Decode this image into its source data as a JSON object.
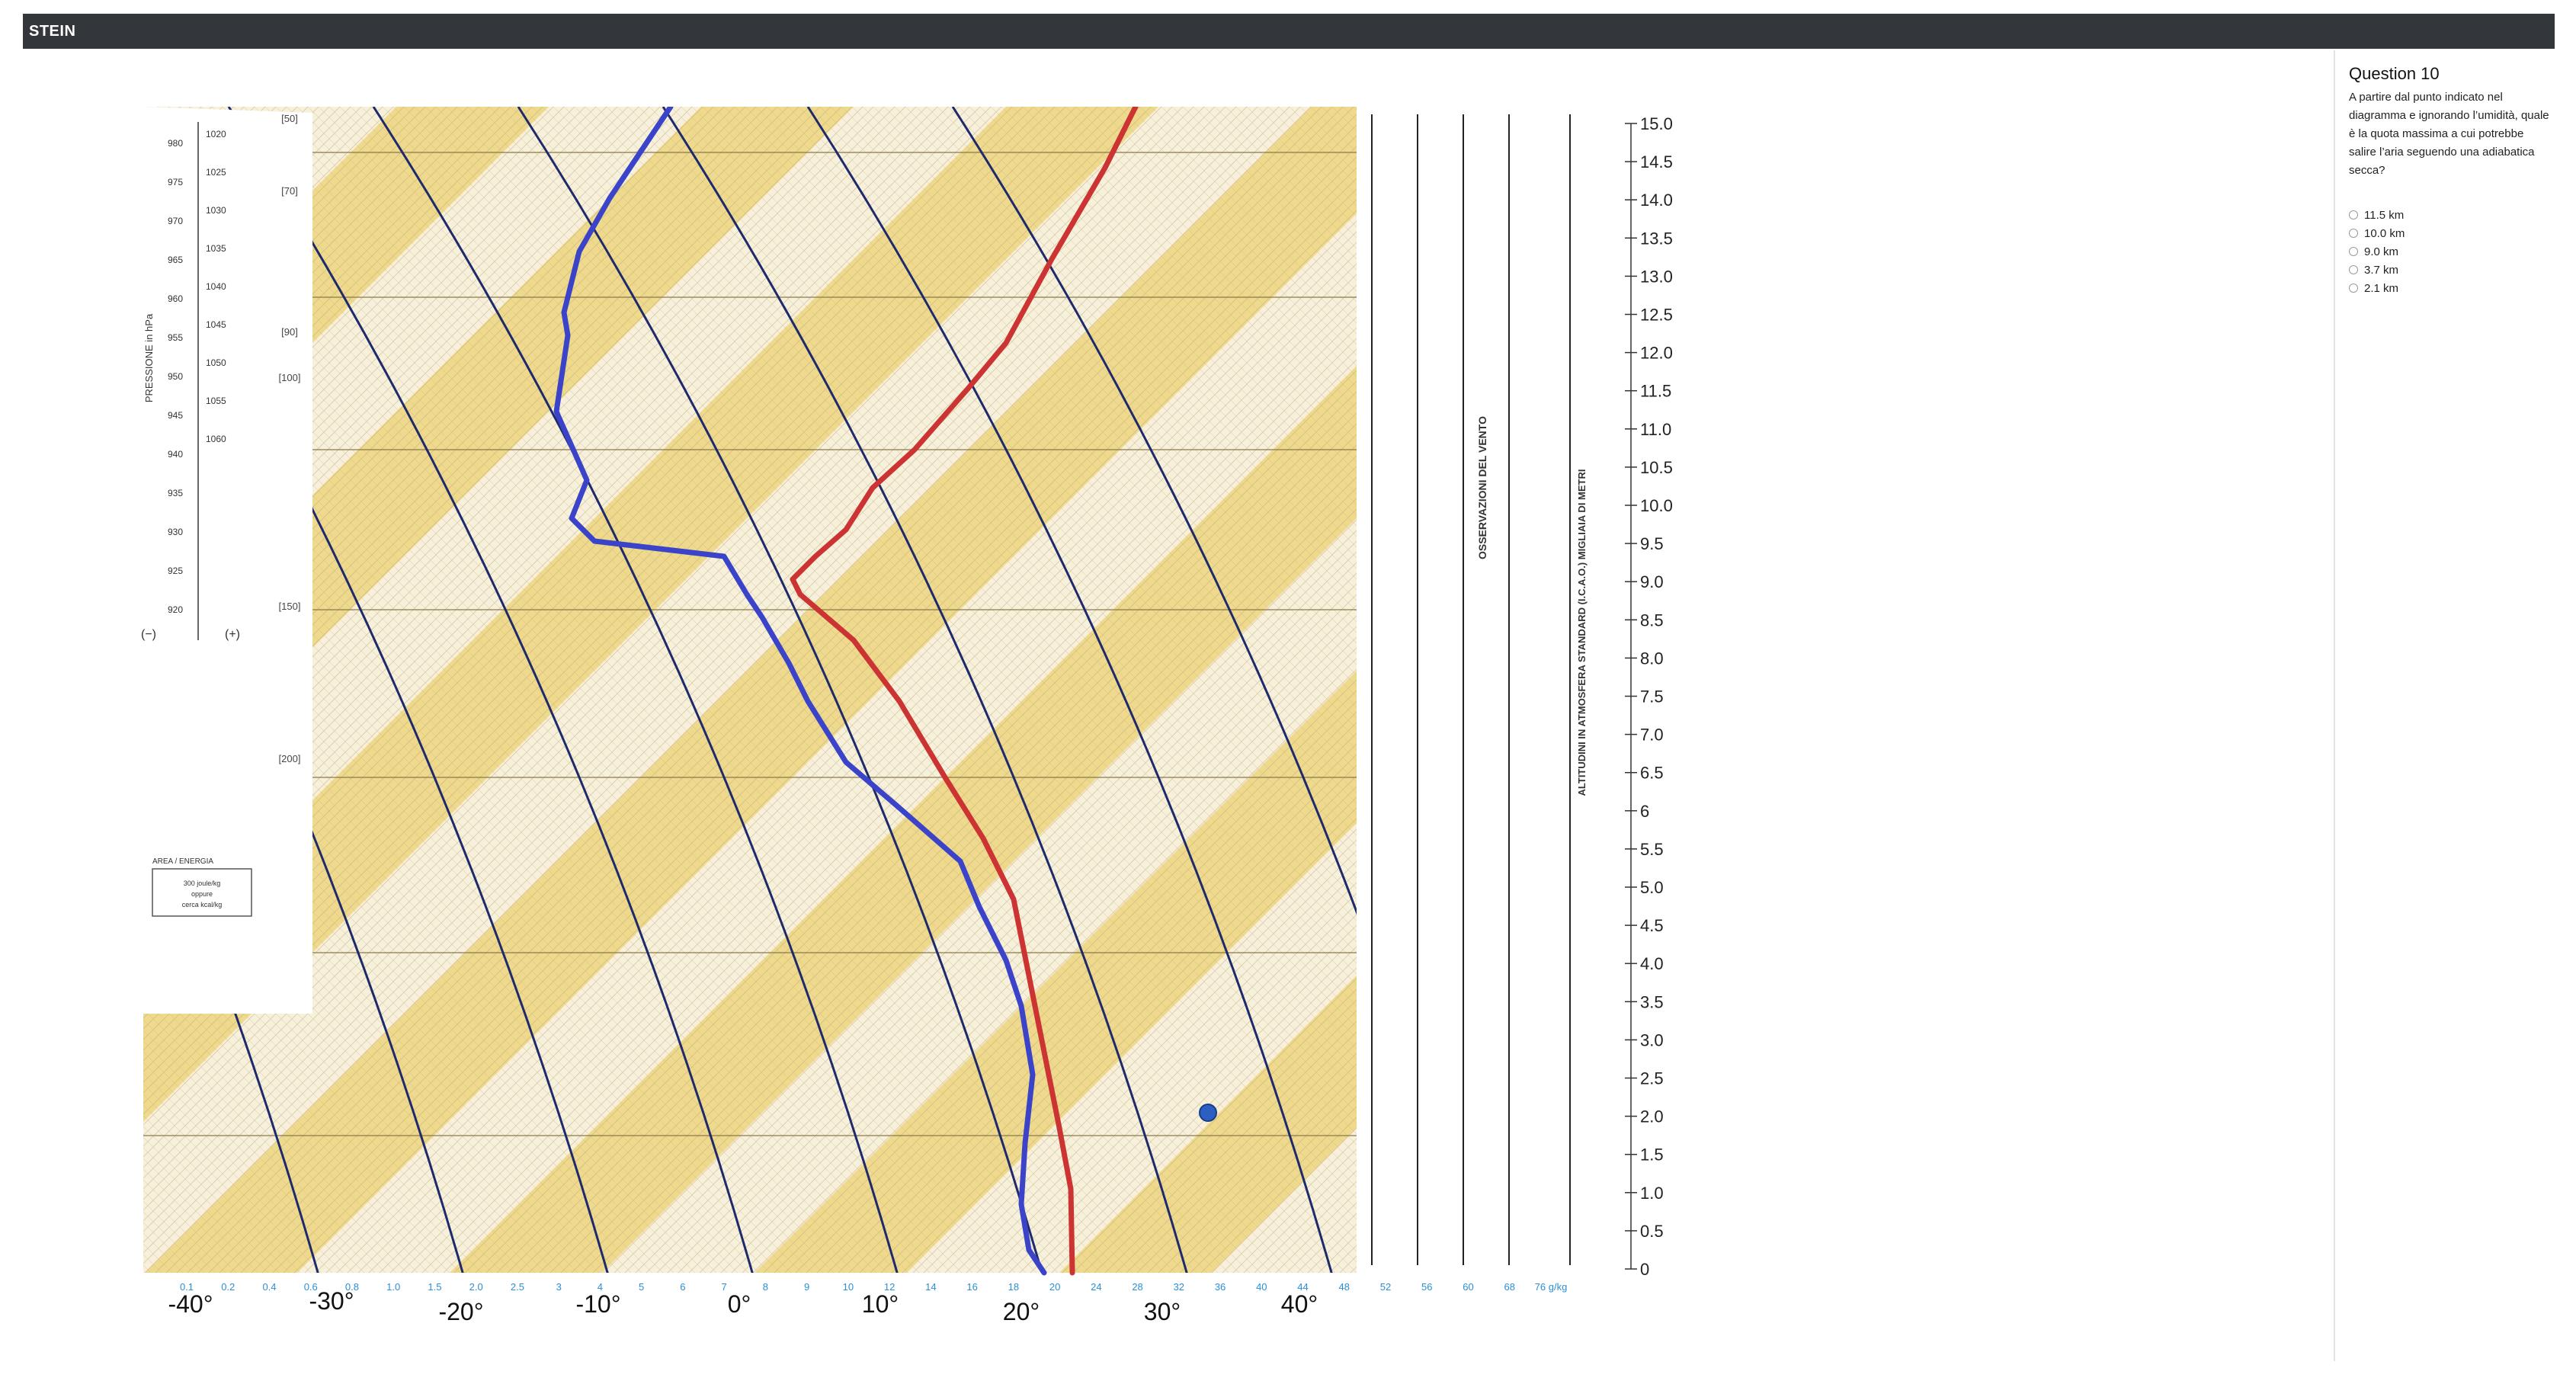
{
  "header": {
    "brand": "STEIN"
  },
  "question": {
    "title": "Question 10",
    "text": "A partire dal punto indicato nel diagramma e ignorando l’umidità, quale è la quota massima a cui potrebbe salire l’aria seguendo una adiabatica secca?",
    "options": [
      {
        "label": "11.5 km"
      },
      {
        "label": "10.0 km"
      },
      {
        "label": "9.0 km"
      },
      {
        "label": "3.7 km"
      },
      {
        "label": "2.1 km"
      }
    ]
  },
  "diagram": {
    "pressure_axis_label": "PRESSIONE in hPa",
    "pressure_ticks_left": [
      "980",
      "975",
      "970",
      "965",
      "960",
      "955",
      "950",
      "945",
      "940",
      "935",
      "930",
      "925",
      "920"
    ],
    "pressure_ticks_right": [
      "1020",
      "1025",
      "1030",
      "1035",
      "1040",
      "1045",
      "1050",
      "1055",
      "1060"
    ],
    "bracket_labels": [
      "[50]",
      "[70]",
      "[90]",
      "[100]",
      "[150]",
      "[200]"
    ],
    "sign_minus": "(−)",
    "sign_plus": "(+)",
    "wind_label": "OSSERVAZIONI DEL VENTO",
    "altitude_label": "ALTITUDINI IN ATMOSFERA STANDARD (I.C.A.O.) MIGLIAIA DI METRI",
    "area_box": {
      "title": "AREA / ENERGIA",
      "line1": "300 joule/kg",
      "line2": "oppure",
      "line3": "cerca kcal/kg"
    },
    "altitude_scale_km": [
      "15.0",
      "14.5",
      "14.0",
      "13.5",
      "13.0",
      "12.5",
      "12.0",
      "11.5",
      "11.0",
      "10.5",
      "10.0",
      "9.5",
      "9.0",
      "8.5",
      "8.0",
      "7.5",
      "7.0",
      "6.5",
      "6",
      "5.5",
      "5.0",
      "4.5",
      "4.0",
      "3.5",
      "3.0",
      "2.5",
      "2.0",
      "1.5",
      "1.0",
      "0.5",
      "0"
    ],
    "temperature_labels": [
      "-40°",
      "-30°",
      "-20°",
      "-10°",
      "0°",
      "10°",
      "20°",
      "30°",
      "40°"
    ],
    "mixing_ratio_labels": [
      "0.1",
      "0.2",
      "0.4",
      "0.6",
      "0.8",
      "1.0",
      "1.5",
      "2.0",
      "2.5",
      "3",
      "4",
      "5",
      "6",
      "7",
      "8",
      "9",
      "10",
      "12",
      "14",
      "16",
      "18",
      "20",
      "24",
      "28",
      "32",
      "36",
      "40",
      "44",
      "48",
      "52",
      "56",
      "60",
      "68",
      "76 g/kg"
    ],
    "colors": {
      "band_yellow": "#efd98c",
      "band_light": "#f7f1dc",
      "environment_curve": "#3b44c9",
      "parcel_curve": "#cc3333",
      "point_marker": "#2b5fc2",
      "scale_blue": "#2a8fd6"
    }
  }
}
